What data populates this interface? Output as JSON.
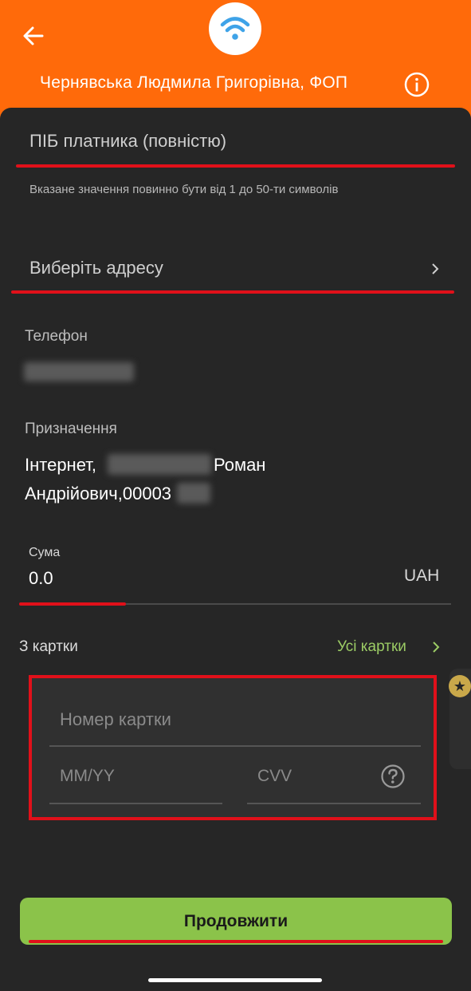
{
  "header": {
    "title": "Чернявська Людмила Григорівна, ФОП",
    "back_icon": "arrow-left-icon",
    "logo_icon": "wifi-icon",
    "info_icon": "info-icon"
  },
  "form": {
    "payer_name": {
      "placeholder": "ПІБ платника (повністю)",
      "hint": "Вказане значення повинно бути від 1 до 50-ти символів"
    },
    "address": {
      "placeholder": "Виберіть адресу"
    },
    "phone": {
      "label": "Телефон"
    },
    "purpose": {
      "label": "Призначення",
      "line1_start": "Інтернет,",
      "line1_end": "Роман",
      "line2": "Андрійович,00003"
    },
    "amount": {
      "label": "Сума",
      "value": "0.0",
      "currency": "UAH"
    }
  },
  "card_section": {
    "label": "З картки",
    "all_cards_link": "Усі картки",
    "card_number_placeholder": "Номер картки",
    "expiry_placeholder": "MM/YY",
    "cvv_placeholder": "CVV"
  },
  "continue_button": "Продовжити",
  "colors": {
    "header_bg": "#ff6a0a",
    "sheet_bg": "#262626",
    "accent_green": "#8bc34a",
    "link_green": "#9ccc65",
    "highlight_red": "#e0101a",
    "logo_blue": "#3fa3e8"
  }
}
